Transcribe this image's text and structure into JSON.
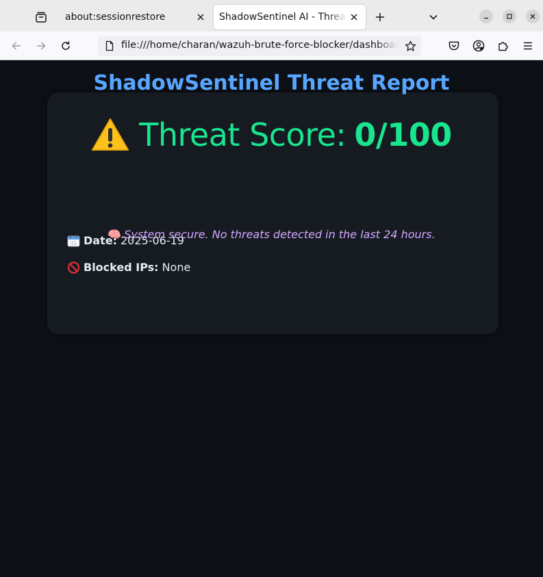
{
  "browser": {
    "tabs": [
      {
        "title": "about:sessionrestore",
        "active": false
      },
      {
        "title": "ShadowSentinel AI - Threat Dashboard",
        "active": true
      }
    ],
    "url": "file:///home/charan/wazuh-brute-force-blocker/dashboard.html"
  },
  "report": {
    "title": "ShadowSentinel Threat Report",
    "score_label": "Threat Score:",
    "score_value": "0/100",
    "date_label": "Date:",
    "date_value": "2025-06-19",
    "blocked_label": "Blocked IPs:",
    "blocked_value": "None",
    "status_icon": "🧠",
    "status_text": "System secure. No threats detected in the last 24 hours."
  },
  "colors": {
    "page_bg": "#0d1117",
    "card_bg": "#161b22",
    "title": "#58a6ff",
    "score": "#19e58f",
    "status": "#d2a8ff"
  }
}
